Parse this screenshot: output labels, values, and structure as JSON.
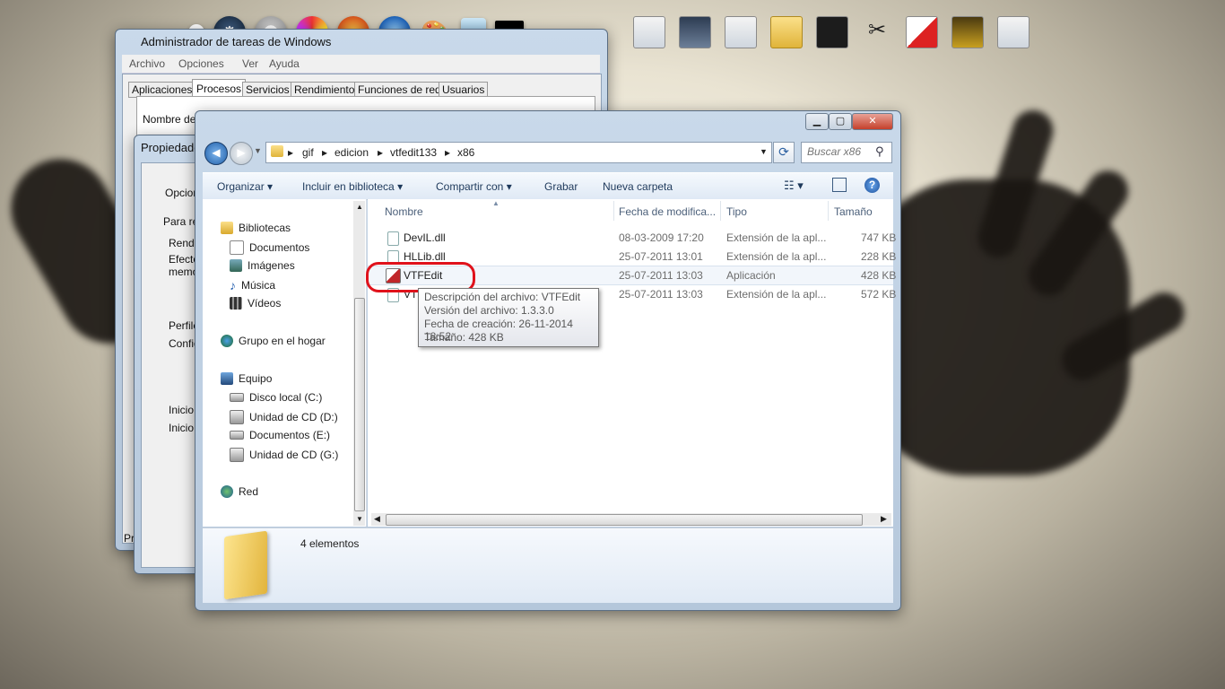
{
  "dock": {
    "left_icons": [
      "ball-icon",
      "steam-icon",
      "eye-icon",
      "paint-app-icon",
      "firefox-icon",
      "globe-icon",
      "palette-icon",
      "tablet-icon",
      "black-window-icon"
    ],
    "right_icons": [
      "window-thumb-1",
      "window-thumb-2",
      "window-thumb-3",
      "folder-thumb",
      "cmd-thumb",
      "scissors-thumb",
      "image-thumb",
      "game-thumb",
      "window-thumb-4"
    ]
  },
  "task_manager": {
    "title": "Administrador de tareas de Windows",
    "menu": [
      "Archivo",
      "Opciones",
      "Ver",
      "Ayuda"
    ],
    "tabs": [
      "Aplicaciones",
      "Procesos",
      "Servicios",
      "Rendimiento",
      "Funciones de red",
      "Usuarios"
    ],
    "column_header": "Nombre de",
    "bottom_text": "Pr"
  },
  "properties": {
    "title": "Propiedade",
    "tab": "Opcion",
    "texts": [
      "Para re",
      "Rendir",
      "Efecto",
      "memor",
      "Perfile",
      "Config",
      "Inicio y",
      "Inicio"
    ]
  },
  "explorer": {
    "breadcrumbs": [
      "gif",
      "edicion",
      "vtfedit133",
      "x86"
    ],
    "search_placeholder": "Buscar x86",
    "toolbar": {
      "organize": "Organizar",
      "include": "Incluir en biblioteca",
      "share": "Compartir con",
      "burn": "Grabar",
      "new_folder": "Nueva carpeta"
    },
    "nav": [
      {
        "label": "Bibliotecas",
        "icon": "library-icon",
        "level": 0
      },
      {
        "label": "Documentos",
        "icon": "document-icon",
        "level": 1
      },
      {
        "label": "Imágenes",
        "icon": "image-icon",
        "level": 1
      },
      {
        "label": "Música",
        "icon": "music-icon",
        "level": 1
      },
      {
        "label": "Vídeos",
        "icon": "video-icon",
        "level": 1
      },
      {
        "label": "Grupo en el hogar",
        "icon": "homegroup-icon",
        "level": 0
      },
      {
        "label": "Equipo",
        "icon": "computer-icon",
        "level": 0
      },
      {
        "label": "Disco local (C:)",
        "icon": "drive-icon",
        "level": 1
      },
      {
        "label": "Unidad de CD (D:)",
        "icon": "cd-drive-icon",
        "level": 1
      },
      {
        "label": "Documentos (E:)",
        "icon": "drive-icon",
        "level": 1
      },
      {
        "label": "Unidad de CD (G:)",
        "icon": "cd-drive-icon",
        "level": 1
      },
      {
        "label": "Red",
        "icon": "network-icon",
        "level": 0
      }
    ],
    "columns": {
      "name": "Nombre",
      "date": "Fecha de modifica...",
      "type": "Tipo",
      "size": "Tamaño"
    },
    "files": [
      {
        "name": "DevIL.dll",
        "date": "08-03-2009 17:20",
        "type": "Extensión de la apl...",
        "size": "747 KB",
        "icon": "dll-icon"
      },
      {
        "name": "HLLib.dll",
        "date": "25-07-2011 13:01",
        "type": "Extensión de la apl...",
        "size": "228 KB",
        "icon": "dll-icon"
      },
      {
        "name": "VTFEdit",
        "date": "25-07-2011 13:03",
        "type": "Aplicación",
        "size": "428 KB",
        "icon": "vtfedit-app-icon"
      },
      {
        "name": "VTFLib.dll",
        "date": "25-07-2011 13:03",
        "type": "Extensión de la apl...",
        "size": "572 KB",
        "icon": "dll-icon"
      }
    ],
    "visible_4th_name": "VT",
    "status": "4 elementos",
    "tooltip": [
      "Descripción del archivo: VTFEdit",
      "Versión del archivo: 1.3.3.0",
      "Fecha de creación: 26-11-2014 18:52",
      "Tamaño: 428 KB"
    ]
  }
}
